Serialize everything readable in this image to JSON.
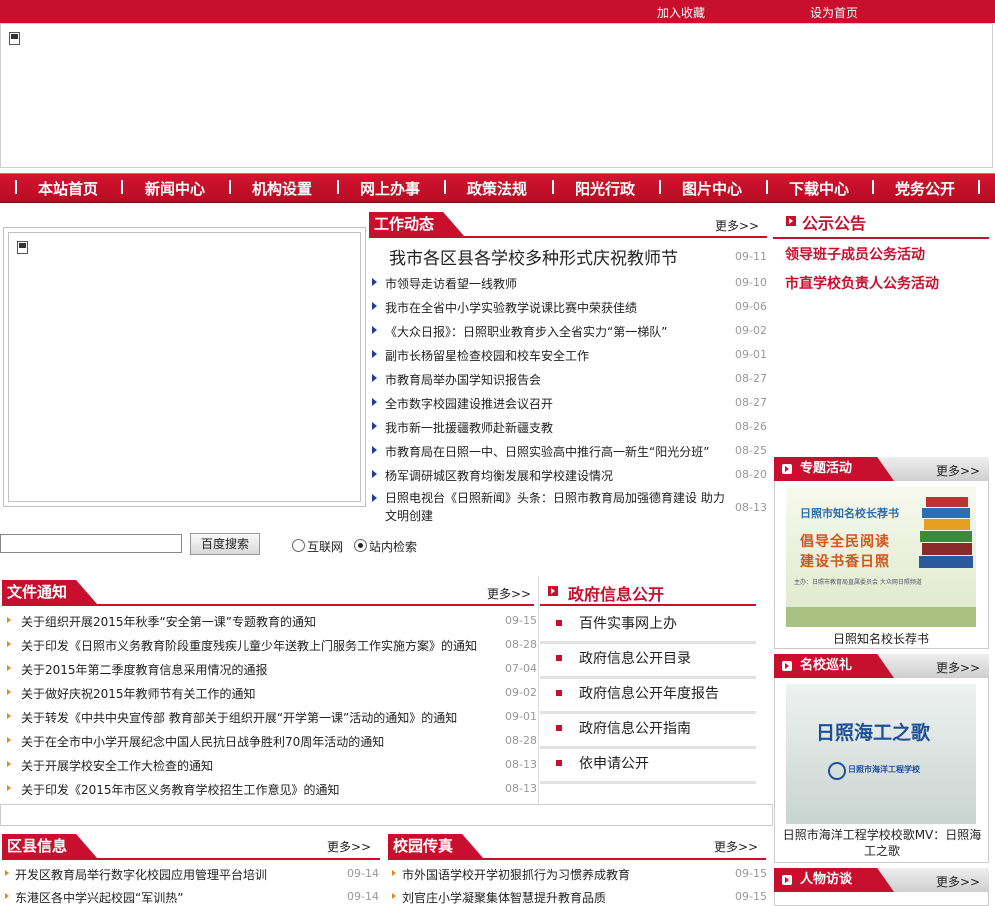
{
  "topbar": {
    "bookmark": "加入收藏",
    "homepage": "设为首页"
  },
  "nav": [
    "本站首页",
    "新闻中心",
    "机构设置",
    "网上办事",
    "政策法规",
    "阳光行政",
    "图片中心",
    "下载中心",
    "党务公开"
  ],
  "work": {
    "title": "工作动态",
    "more": "更多>>",
    "headline": {
      "text": "我市各区县各学校多种形式庆祝教师节",
      "date": "09-11"
    },
    "items": [
      {
        "text": "市领导走访看望一线教师",
        "date": "09-10"
      },
      {
        "text": "我市在全省中小学实验教学说课比赛中荣获佳绩",
        "date": "09-06"
      },
      {
        "text": "《大众日报》：日照职业教育步入全省实力“第一梯队”",
        "date": "09-02"
      },
      {
        "text": "副市长杨留星检查校园和校车安全工作",
        "date": "09-01"
      },
      {
        "text": "市教育局举办国学知识报告会",
        "date": "08-27"
      },
      {
        "text": "全市数字校园建设推进会议召开",
        "date": "08-27"
      },
      {
        "text": "我市新一批援疆教师赴新疆支教",
        "date": "08-26"
      },
      {
        "text": "市教育局在日照一中、日照实验高中推行高一新生“阳光分班”",
        "date": "08-25"
      },
      {
        "text": "杨军调研城区教育均衡发展和学校建设情况",
        "date": "08-20"
      },
      {
        "text": "日照电视台《日照新闻》头条：日照市教育局加强德育建设 助力文明创建",
        "date": "08-13"
      }
    ]
  },
  "notice": {
    "title": "公示公告",
    "items": [
      "领导班子成员公务活动",
      "市直学校负责人公务活动"
    ]
  },
  "search": {
    "button": "百度搜索",
    "opt1": "互联网",
    "opt2": "站内检索"
  },
  "files": {
    "title": "文件通知",
    "more": "更多>>",
    "items": [
      {
        "text": "关于组织开展2015年秋季“安全第一课”专题教育的通知",
        "date": "09-15"
      },
      {
        "text": "关于印发《日照市义务教育阶段重度残疾儿童少年送教上门服务工作实施方案》的通知",
        "date": "08-28"
      },
      {
        "text": "关于2015年第二季度教育信息采用情况的通报",
        "date": "07-04"
      },
      {
        "text": "关于做好庆祝2015年教师节有关工作的通知",
        "date": "09-02"
      },
      {
        "text": "关于转发《中共中央宣传部 教育部关于组织开展“开学第一课”活动的通知》的通知",
        "date": "09-01"
      },
      {
        "text": "关于在全市中小学开展纪念中国人民抗日战争胜利70周年活动的通知",
        "date": "08-28"
      },
      {
        "text": "关于开展学校安全工作大检查的通知",
        "date": "08-13"
      },
      {
        "text": "关于印发《2015年市区义务教育学校招生工作意见》的通知",
        "date": "08-13"
      }
    ]
  },
  "gov": {
    "title": "政府信息公开",
    "items": [
      "百件实事网上办",
      "政府信息公开目录",
      "政府信息公开年度报告",
      "政府信息公开指南",
      "依申请公开"
    ]
  },
  "district": {
    "title": "区县信息",
    "more": "更多>>",
    "items": [
      {
        "text": "开发区教育局举行数字化校园应用管理平台培训",
        "date": "09-14"
      },
      {
        "text": "东港区各中学兴起校园“军训热”",
        "date": "09-14"
      }
    ]
  },
  "campus": {
    "title": "校园传真",
    "more": "更多>>",
    "items": [
      {
        "text": "市外国语学校开学初狠抓行为习惯养成教育",
        "date": "09-15"
      },
      {
        "text": "刘官庄小学凝聚集体智慧提升教育品质",
        "date": "09-15"
      }
    ]
  },
  "side": {
    "special": {
      "title": "专题活动",
      "more": "更多>>",
      "poster_top": "日照市知名校长荐书",
      "poster_l1": "倡导全民阅读",
      "poster_l2": "建设书香日照",
      "poster_small": "主办：日照市教育局直属委员会  大众网日照频道",
      "caption": "日照知名校长荐书"
    },
    "school": {
      "title": "名校巡礼",
      "more": "更多>>",
      "poster_title": "日照海工之歌",
      "poster_sub": "日照市海洋工程学校",
      "caption": "日照市海洋工程学校校歌MV：日照海工之歌"
    },
    "people": {
      "title": "人物访谈",
      "more": "更多>>"
    }
  },
  "colors": {
    "brand_red": "#c8102e",
    "bullet_blue": "#1f3c88",
    "bullet_orange": "#e08a20"
  }
}
